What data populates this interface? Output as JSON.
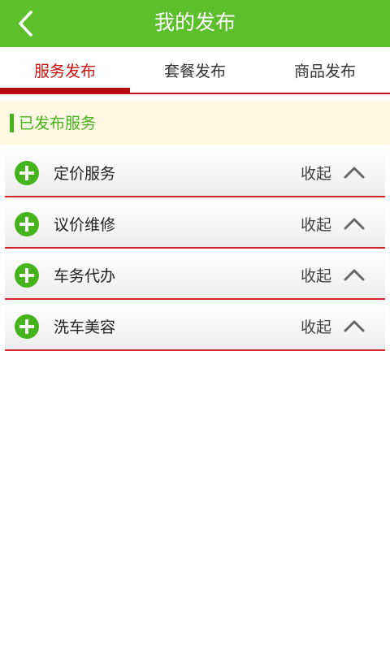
{
  "header": {
    "title": "我的发布",
    "back_icon": "back-arrow-icon"
  },
  "tabs": [
    {
      "label": "服务发布",
      "active": true
    },
    {
      "label": "套餐发布",
      "active": false
    },
    {
      "label": "商品发布",
      "active": false
    }
  ],
  "section": {
    "title": "已发布服务"
  },
  "services": [
    {
      "label": "定价服务",
      "action": "收起",
      "icon": "plus-circle-icon"
    },
    {
      "label": "议价维修",
      "action": "收起",
      "icon": "plus-circle-icon"
    },
    {
      "label": "车务代办",
      "action": "收起",
      "icon": "plus-circle-icon"
    },
    {
      "label": "洗车美容",
      "action": "收起",
      "icon": "plus-circle-icon"
    }
  ],
  "colors": {
    "header_bg": "#5dbf2c",
    "active_tab": "#cc1010",
    "accent_green": "#45b31c",
    "row_divider": "#d2262b",
    "section_bg": "#fff8e3"
  }
}
